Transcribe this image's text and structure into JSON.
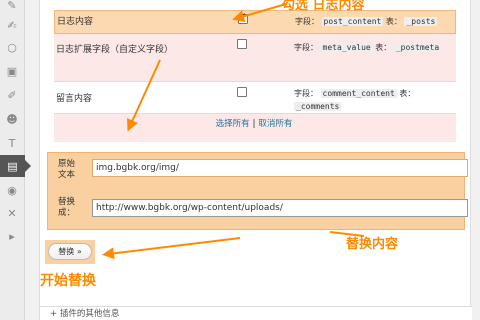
{
  "sidebar": {
    "icons": [
      "pin-icon",
      "comment-icon",
      "appearance-icon",
      "plugins-icon",
      "users-icon",
      "tools-icon",
      "settings-icon",
      "active-plugin-icon",
      "circle-icon",
      "cross-icon",
      "collapse-icon"
    ]
  },
  "rows": [
    {
      "label": "日志内容",
      "checked": true,
      "field_label": "字段：",
      "field": "post_content",
      "table_label": "表：",
      "table": "_posts"
    },
    {
      "label": "日志扩展字段（自定义字段）",
      "checked": false,
      "field_label": "字段：",
      "field": "meta_value",
      "table_label": "表：",
      "table": "_postmeta"
    },
    {
      "label": "留言内容",
      "checked": false,
      "field_label": "字段：",
      "field": "comment_content",
      "table_label": "表：",
      "table": "_comments"
    }
  ],
  "select_all": "选择所有",
  "separator": "|",
  "cancel_all": "取消所有",
  "original_label": "原始文本",
  "original_value": "img.bgbk.org/img/",
  "replace_label": "替换成：",
  "replace_value": "http://www.bgbk.org/wp-content/uploads/",
  "start_button": "替换 »",
  "footer": "+ 插件的其他信息",
  "annotations": {
    "top": "勾选   日志内容",
    "replace": "替换内容",
    "start": "开始替换"
  },
  "colors": {
    "accent": "#ff8a00",
    "highlight": "#fcd9b0",
    "row_pink": "#fde8e8",
    "link": "#21759b"
  }
}
